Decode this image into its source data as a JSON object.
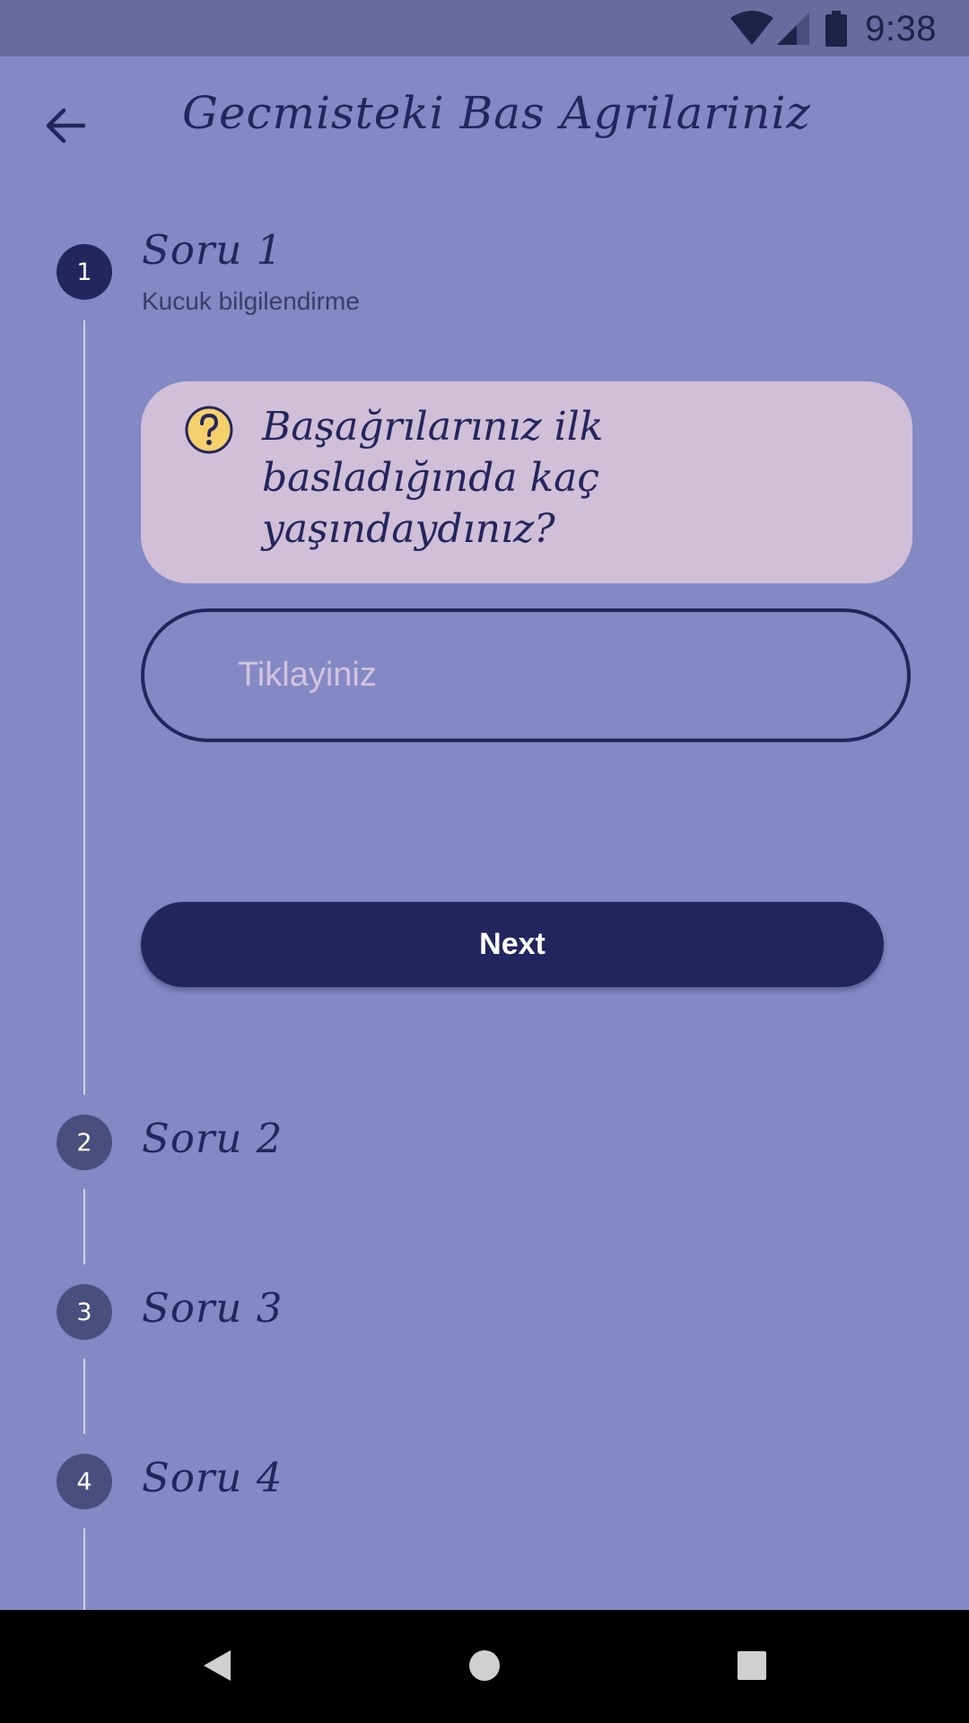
{
  "status_bar": {
    "time": "9:38",
    "icons": [
      "wifi-icon",
      "cellular-signal-icon",
      "battery-icon"
    ]
  },
  "app_bar": {
    "back_icon": "arrow-back-icon",
    "title": "Gecmisteki Bas Agrilariniz"
  },
  "stepper": {
    "steps": [
      {
        "number": "1",
        "title": "Soru 1",
        "subtitle": "Kucuk bilgilendirme",
        "active": true
      },
      {
        "number": "2",
        "title": "Soru 2",
        "active": false
      },
      {
        "number": "3",
        "title": "Soru 3",
        "active": false
      },
      {
        "number": "4",
        "title": "Soru 4",
        "active": false
      }
    ]
  },
  "question": {
    "icon": "question-mark-icon",
    "text": "Başağrılarınız ilk basladığında kaç yaşındaydınız?"
  },
  "answer_input": {
    "value": "",
    "placeholder": "Tiklayiniz"
  },
  "next_button": {
    "label": "Next"
  },
  "nav_bar": {
    "icons": [
      "back-triangle-icon",
      "home-circle-icon",
      "recents-square-icon"
    ]
  },
  "colors": {
    "background": "#8289c5",
    "status_bar": "#676b9d",
    "primary_dark": "#23265e",
    "inactive_step": "#4a4e7d",
    "card": "#d1bfd7",
    "placeholder": "#d4c3da",
    "help_icon_fill": "#f6d06a"
  }
}
